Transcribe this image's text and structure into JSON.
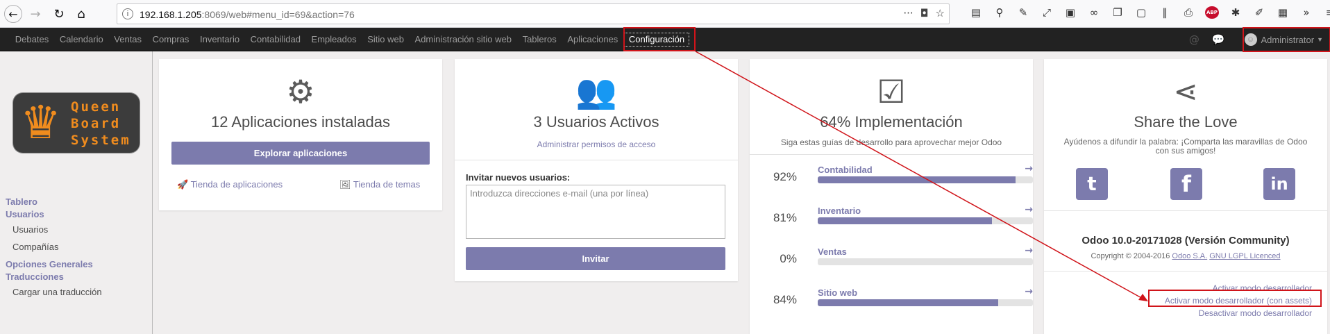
{
  "browser": {
    "url_host": "192.168.1.205",
    "url_rest": ":8069/web#menu_id=69&action=76"
  },
  "topmenu": {
    "items": [
      "Debates",
      "Calendario",
      "Ventas",
      "Compras",
      "Inventario",
      "Contabilidad",
      "Empleados",
      "Sitio web",
      "Administración sitio web",
      "Tableros",
      "Aplicaciones",
      "Configuración"
    ],
    "active": "Configuración",
    "user": "Administrator"
  },
  "logo": {
    "line1": "Queen",
    "line2": "Board",
    "line3": "System"
  },
  "sidebar": {
    "head1a": "Tablero",
    "head1b": "Usuarios",
    "users": "Usuarios",
    "companies": "Compañías",
    "head2a": "Opciones Generales",
    "head2b": "Traducciones",
    "load_translation": "Cargar una traducción"
  },
  "apps_card": {
    "title": "12 Aplicaciones instaladas",
    "button": "Explorar aplicaciones",
    "app_store": "Tienda de aplicaciones",
    "theme_store": "Tienda de temas"
  },
  "users_card": {
    "title": "3 Usuarios Activos",
    "manage": "Administrar permisos de acceso",
    "invite_label": "Invitar nuevos usuarios:",
    "invite_placeholder": "Introduzca direcciones e-mail (una por línea)",
    "invite_button": "Invitar"
  },
  "impl_card": {
    "title": "64% Implementación",
    "subtitle": "Siga estas guías de desarrollo para aprovechar mejor Odoo",
    "rows": [
      {
        "pct": "92%",
        "name": "Contabilidad",
        "value": 0.92
      },
      {
        "pct": "81%",
        "name": "Inventario",
        "value": 0.81
      },
      {
        "pct": "0%",
        "name": "Ventas",
        "value": 0.0
      },
      {
        "pct": "84%",
        "name": "Sitio web",
        "value": 0.84
      }
    ]
  },
  "share_card": {
    "title": "Share the Love",
    "subtitle": "Ayúdenos a difundir la palabra: ¡Comparta las maravillas de Odoo con sus amigos!",
    "version": "Odoo 10.0-20171028 (Versión Community)",
    "copyright_pre": "Copyright © 2004-2016 ",
    "company": "Odoo S.A.",
    "license": "GNU LGPL Licenced",
    "dev_on": "Activar modo desarrollador",
    "dev_assets": "Activar modo desarrollador (con assets)",
    "dev_off": "Desactivar modo desarrollador"
  },
  "colors": {
    "accent": "#7c7bad",
    "highlight": "#d0141a",
    "topbar": "#222222"
  }
}
